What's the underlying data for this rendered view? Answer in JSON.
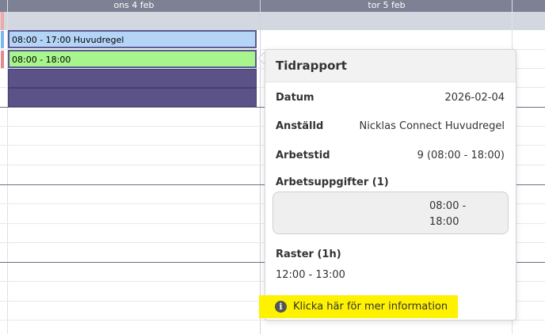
{
  "calendar": {
    "days": [
      {
        "label": "ons 4 feb"
      },
      {
        "label": "tor 5 feb"
      }
    ],
    "events": [
      {
        "label": "08:00 - 17:00 Huvudregel",
        "color": "#b5d5f7"
      },
      {
        "label": "08:00 - 18:00",
        "color": "#a7f58c"
      }
    ],
    "marker_colors": {
      "pink": "#f0a8a8",
      "blue": "#79b9ef",
      "red": "#e08c8c",
      "block": "#5b5287"
    }
  },
  "popover": {
    "title": "Tidrapport",
    "rows": {
      "datum": {
        "label": "Datum",
        "value": "2026-02-04"
      },
      "anstalld": {
        "label": "Anställd",
        "value": "Nicklas Connect Huvudregel"
      },
      "arbetstid": {
        "label": "Arbetstid",
        "value": "9 (08:00 - 18:00)"
      }
    },
    "tasks": {
      "label": "Arbetsuppgifter (1)",
      "time_line1": "08:00 -",
      "time_line2": "18:00"
    },
    "breaks": {
      "label": "Raster (1h)",
      "value": "12:00 - 13:00"
    },
    "info_link": {
      "icon": "info-icon",
      "label": "Klicka här för mer information"
    }
  }
}
